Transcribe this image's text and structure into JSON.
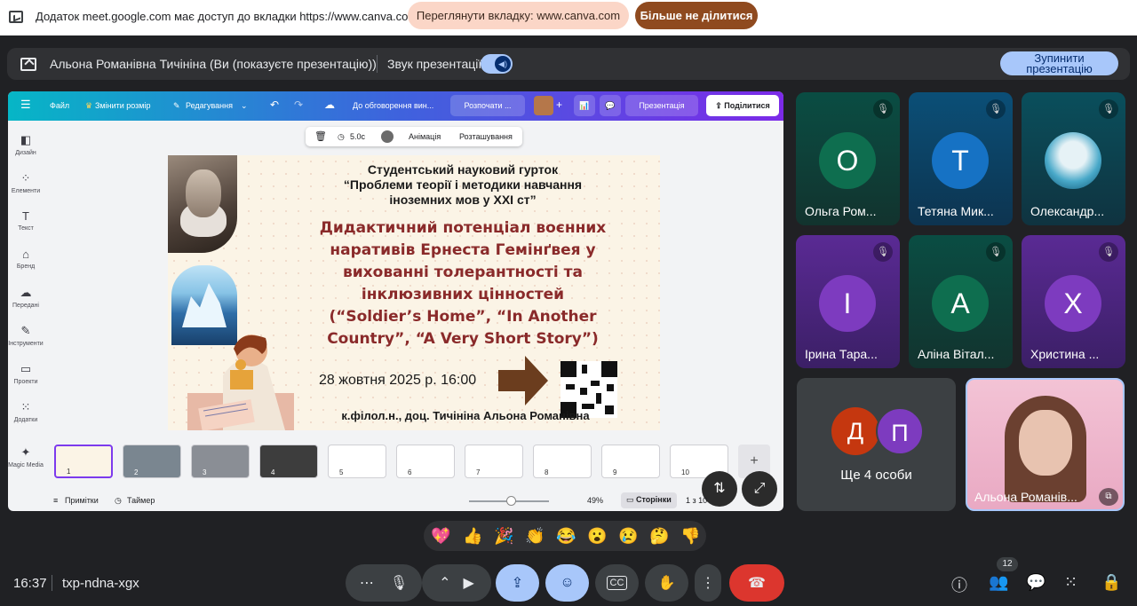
{
  "share_notice": {
    "message": "Додаток meet.google.com має доступ до вкладки https://www.canva.com",
    "view_tab_label": "Переглянути вкладку: www.canva.com",
    "stop_sharing_label": "Більше не ділитися"
  },
  "presenting_bar": {
    "presenter_text": "Альона Романівна Тичініна (Ви (показуєте презентацію))",
    "audio_label": "Звук презентації",
    "stop_label": "Зупинити презентацію"
  },
  "canva": {
    "toolbar": {
      "file": "Файл",
      "resize": "Змінити розмір",
      "edit": "Редагування",
      "discussion": "До обговорення вин...",
      "start": "Розпочати ...",
      "present": "Презентація",
      "share": "Поділитися"
    },
    "sidebar": [
      "Дизайн",
      "Елементи",
      "Текст",
      "Бренд",
      "Передані",
      "Інструменти",
      "Проекти",
      "Додатки",
      "Magic Media"
    ],
    "floating": {
      "duration": "5.0с",
      "animation": "Анімація",
      "position": "Розташування"
    },
    "slide": {
      "header_line1": "Студентський науковий гурток",
      "header_line2": "“Проблеми теорії і методики навчання",
      "header_line3": "іноземних мов у XXI ст”",
      "title_line1": "Дидактичний потенціал воєнних",
      "title_line2": "наративів Ернеста Гемінґвея у",
      "title_line3": "вихованні толерантності та",
      "title_line4": "інклюзивних цінностей",
      "title_line5": "(“Soldier’s Home”, “In Another",
      "title_line6": "Country”, “A Very Short Story”)",
      "date": "28 жовтня 2025 р. 16:00",
      "author": "к.філол.н., доц. Тичініна Альона Романівна"
    },
    "thumbnails": [
      "1",
      "2",
      "3",
      "4",
      "5",
      "6",
      "7",
      "8",
      "9",
      "10"
    ],
    "bottom": {
      "notes": "Примітки",
      "timer": "Таймер",
      "zoom": "49%",
      "pages": "Сторінки",
      "page_count": "1 з 10"
    }
  },
  "participants": [
    {
      "initial": "О",
      "name": "Ольга Ром...",
      "color": "#0e6e4f"
    },
    {
      "initial": "Т",
      "name": "Тетяна Мик...",
      "color": "#1672c4"
    },
    {
      "initial": "",
      "name": "Олександр...",
      "color": "#2aa0c9"
    },
    {
      "initial": "І",
      "name": "Ірина Тара...",
      "color": "#7d3bbf"
    },
    {
      "initial": "А",
      "name": "Аліна Вітал...",
      "color": "#0e6e4f"
    },
    {
      "initial": "Х",
      "name": "Христина ...",
      "color": "#7d3bbf"
    }
  ],
  "more_people": {
    "a": "Д",
    "b": "П",
    "label": "Ще 4 особи"
  },
  "self_view": {
    "name": "Альона Романів..."
  },
  "emojis": [
    "💖",
    "👍",
    "🎉",
    "👏",
    "😂",
    "😮",
    "😢",
    "🤔",
    "👎"
  ],
  "footer": {
    "time": "16:37",
    "meeting_code": "txp-ndna-xgx",
    "people_count": "12"
  }
}
